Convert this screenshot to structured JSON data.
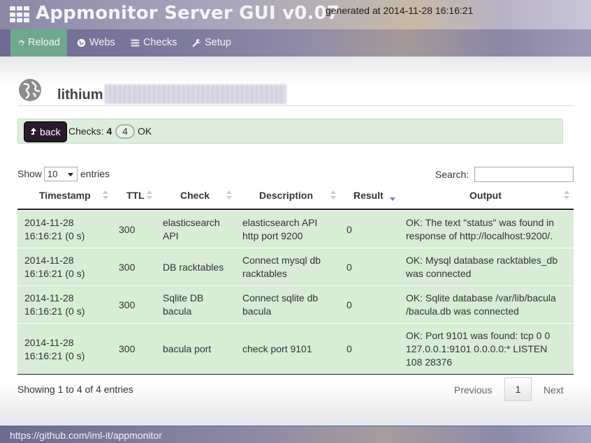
{
  "header": {
    "app_title": "Appmonitor Server GUI v0.07",
    "generated": "generated at 2014-11-28 16:16:21"
  },
  "nav": {
    "items": [
      {
        "label": "Reload",
        "icon": "refresh-icon"
      },
      {
        "label": "Webs",
        "icon": "globe-icon"
      },
      {
        "label": "Checks",
        "icon": "list-icon"
      },
      {
        "label": "Setup",
        "icon": "wrench-icon"
      }
    ]
  },
  "host": {
    "name": "lithium"
  },
  "checkbar": {
    "back_label": "back",
    "checks_label": "Checks:",
    "checks_count": "4",
    "ok_count": "4",
    "ok_label": "OK"
  },
  "table_controls": {
    "show_label": "Show",
    "length_value": "10",
    "entries_label": "entries",
    "search_label": "Search:",
    "search_value": ""
  },
  "table": {
    "columns": [
      "Timestamp",
      "TTL",
      "Check",
      "Description",
      "Result",
      "Output"
    ],
    "rows": [
      {
        "timestamp": [
          "2014-11-28",
          "16:16:21 (0 s)"
        ],
        "ttl": "300",
        "check": [
          "elasticsearch",
          "API"
        ],
        "description": [
          "elasticsearch API",
          "http port 9200"
        ],
        "result": "0",
        "output": [
          "OK: The text \"status\" was found in",
          "response of http://localhost:9200/."
        ]
      },
      {
        "timestamp": [
          "2014-11-28",
          "16:16:21 (0 s)"
        ],
        "ttl": "300",
        "check": [
          "DB racktables"
        ],
        "description": [
          "Connect mysql db",
          "racktables"
        ],
        "result": "0",
        "output": [
          "OK: Mysql database racktables_db",
          "was connected"
        ]
      },
      {
        "timestamp": [
          "2014-11-28",
          "16:16:21 (0 s)"
        ],
        "ttl": "300",
        "check": [
          "Sqlite DB",
          "bacula"
        ],
        "description": [
          "Connect sqlite db",
          "bacula"
        ],
        "result": "0",
        "output": [
          "OK: Sqlite database /var/lib/bacula",
          "/bacula.db was connected"
        ]
      },
      {
        "timestamp": [
          "2014-11-28",
          "16:16:21 (0 s)"
        ],
        "ttl": "300",
        "check": [
          "bacula port"
        ],
        "description": [
          "check port 9101"
        ],
        "result": "0",
        "output": [
          "OK: Port 9101 was found: tcp 0 0",
          "127.0.0.1:9101 0.0.0.0:* LISTEN",
          "108 28376"
        ]
      }
    ]
  },
  "pagination": {
    "info": "Showing 1 to 4 of 4 entries",
    "previous": "Previous",
    "current": "1",
    "next": "Next"
  },
  "footer": {
    "link": "https://github.com/iml-it/appmonitor"
  },
  "colors": {
    "nav_active": "#6fa88c",
    "row_bg": "#d8ecd6",
    "back_button": "#2a1a2b",
    "sort_active": "#7b7fc9"
  }
}
